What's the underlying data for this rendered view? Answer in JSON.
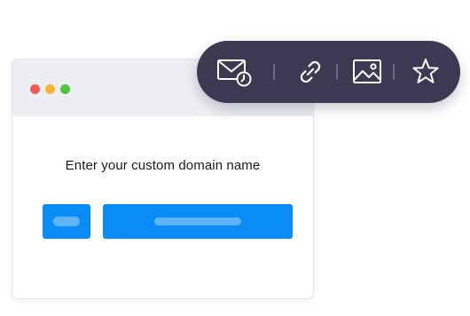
{
  "colors": {
    "toolbar_bg": "#3b3a52",
    "toolbar_icon": "#ffffff",
    "toolbar_separator": "#6c6b83",
    "primary_button": "#0a8cf6",
    "dot_red": "#f05a52",
    "dot_yellow": "#f5b631",
    "dot_green": "#4cc53f"
  },
  "window": {
    "prompt_text": "Enter your custom domain name"
  },
  "toolbar": {
    "icons": [
      "mail-clock-icon",
      "link-icon",
      "image-icon",
      "star-icon"
    ]
  }
}
